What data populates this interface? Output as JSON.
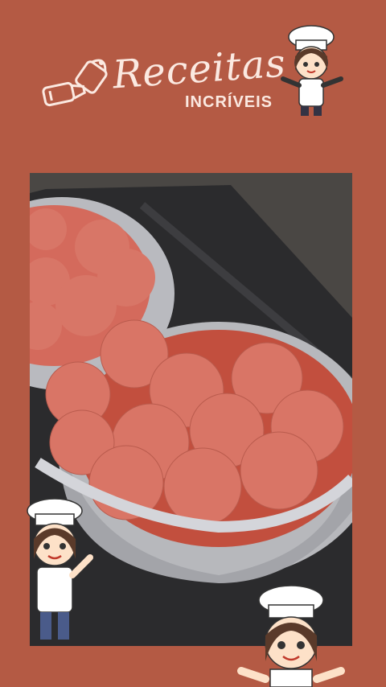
{
  "brand": {
    "title": "Receitas",
    "subtitle": "INCRÍVEIS"
  },
  "colors": {
    "background": "#b45a44",
    "text": "#fbe9e1",
    "meat": "#d86d5f",
    "foil": "#c6c7cb"
  },
  "icons": {
    "salt": "salt-shaker-icon",
    "pepper": "pepper-shaker-icon",
    "chef": "chef-mascot-icon"
  }
}
